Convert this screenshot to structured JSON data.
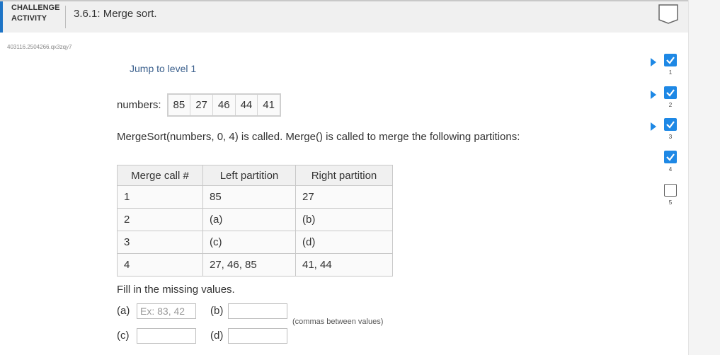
{
  "header": {
    "challenge_line1": "CHALLENGE",
    "challenge_line2": "ACTIVITY",
    "title": "3.6.1: Merge sort."
  },
  "activity_id": "403116.2504266.qx3zqy7",
  "jump_label": "Jump to level 1",
  "numbers_label": "numbers:",
  "numbers": [
    "85",
    "27",
    "46",
    "44",
    "41"
  ],
  "description": "MergeSort(numbers, 0, 4) is called. Merge() is called to merge the following partitions:",
  "table": {
    "headers": [
      "Merge call #",
      "Left partition",
      "Right partition"
    ],
    "rows": [
      [
        "1",
        "85",
        "27"
      ],
      [
        "2",
        "(a)",
        "(b)"
      ],
      [
        "3",
        "(c)",
        "(d)"
      ],
      [
        "4",
        "27, 46, 85",
        "41, 44"
      ]
    ]
  },
  "fill_prompt": "Fill in the missing values.",
  "inputs": {
    "a_label": "(a)",
    "a_placeholder": "Ex: 83, 42",
    "b_label": "(b)",
    "c_label": "(c)",
    "d_label": "(d)"
  },
  "hint": "(commas between values)",
  "levels": [
    {
      "num": "1",
      "completed": true
    },
    {
      "num": "2",
      "completed": true
    },
    {
      "num": "3",
      "completed": true
    },
    {
      "num": "4",
      "completed": true
    },
    {
      "num": "5",
      "completed": false
    }
  ],
  "colors": {
    "accent": "#1e74c6",
    "level_done": "#1e88e5",
    "link": "#3a5f8c"
  }
}
